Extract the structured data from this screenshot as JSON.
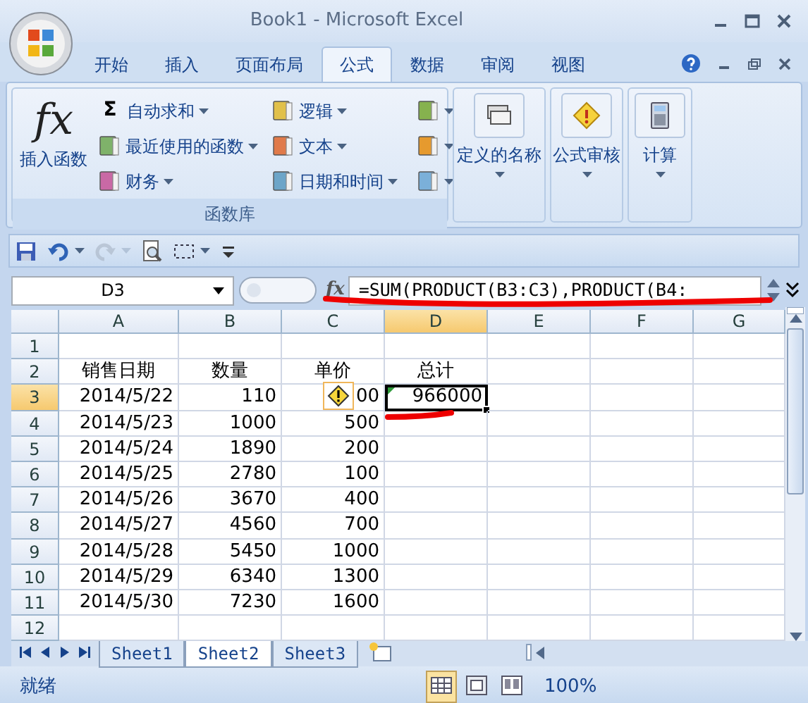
{
  "window": {
    "title": "Book1 - Microsoft Excel"
  },
  "ribbon_tabs": [
    {
      "label": "开始",
      "selected": false
    },
    {
      "label": "插入",
      "selected": false
    },
    {
      "label": "页面布局",
      "selected": false
    },
    {
      "label": "公式",
      "selected": true
    },
    {
      "label": "数据",
      "selected": false
    },
    {
      "label": "审阅",
      "selected": false
    },
    {
      "label": "视图",
      "selected": false
    }
  ],
  "function_library": {
    "label": "函数库",
    "insert_function": {
      "glyph": "fx",
      "label": "插入函数"
    },
    "items": [
      {
        "kind": "sigma",
        "icon_text": "Σ",
        "label": "自动求和"
      },
      {
        "kind": "book",
        "label": "最近使用的函数"
      },
      {
        "kind": "book",
        "label": "财务"
      },
      {
        "kind": "book",
        "label": "逻辑"
      },
      {
        "kind": "book",
        "label": "文本"
      },
      {
        "kind": "book",
        "label": "日期和时间"
      },
      {
        "kind": "icon"
      },
      {
        "kind": "icon"
      },
      {
        "kind": "icon"
      }
    ]
  },
  "ribbon_groups": [
    {
      "label": "定义的名称",
      "kind": "names"
    },
    {
      "label": "公式审核",
      "kind": "audit"
    },
    {
      "label": "计算",
      "kind": "calc"
    }
  ],
  "quick_access": [
    {
      "kind": "save",
      "disabled": false
    },
    {
      "kind": "undo",
      "disabled": false,
      "dropdown": true
    },
    {
      "kind": "redo",
      "disabled": true,
      "dropdown": true
    },
    {
      "kind": "preview",
      "disabled": false
    },
    {
      "kind": "select",
      "disabled": false,
      "dropdown": true
    },
    {
      "kind": "customize",
      "disabled": false
    }
  ],
  "formula_bar": {
    "name_box": "D3",
    "fx": "fx",
    "formula": "=SUM(PRODUCT(B3:C3),PRODUCT(B4:"
  },
  "columns": [
    {
      "label": "A",
      "selected": false
    },
    {
      "label": "B",
      "selected": false
    },
    {
      "label": "C",
      "selected": false
    },
    {
      "label": "D",
      "selected": true
    },
    {
      "label": "E",
      "selected": false
    },
    {
      "label": "F",
      "selected": false
    },
    {
      "label": "G",
      "selected": false
    }
  ],
  "rows": [
    {
      "label": "1",
      "selected": false,
      "cells": []
    },
    {
      "label": "2",
      "selected": false,
      "kind": "heading",
      "cells": [
        {
          "text": "销售日期"
        },
        {
          "text": "数量"
        },
        {
          "text": "单价"
        },
        {
          "text": "总计"
        }
      ]
    },
    {
      "label": "3",
      "selected": true,
      "kind": "data",
      "cells": [
        {
          "text": "2014/5/22"
        },
        {
          "text": "110"
        },
        {
          "text": "00",
          "error_button": true
        },
        {
          "text": "966000",
          "active": true,
          "error_indicator": true
        }
      ]
    },
    {
      "label": "4",
      "selected": false,
      "kind": "data",
      "cells": [
        {
          "text": "2014/5/23"
        },
        {
          "text": "1000"
        },
        {
          "text": "500"
        }
      ]
    },
    {
      "label": "5",
      "selected": false,
      "kind": "data",
      "cells": [
        {
          "text": "2014/5/24"
        },
        {
          "text": "1890"
        },
        {
          "text": "200"
        }
      ]
    },
    {
      "label": "6",
      "selected": false,
      "kind": "data",
      "cells": [
        {
          "text": "2014/5/25"
        },
        {
          "text": "2780"
        },
        {
          "text": "100"
        }
      ]
    },
    {
      "label": "7",
      "selected": false,
      "kind": "data",
      "cells": [
        {
          "text": "2014/5/26"
        },
        {
          "text": "3670"
        },
        {
          "text": "400"
        }
      ]
    },
    {
      "label": "8",
      "selected": false,
      "kind": "data",
      "cells": [
        {
          "text": "2014/5/27"
        },
        {
          "text": "4560"
        },
        {
          "text": "700"
        }
      ]
    },
    {
      "label": "9",
      "selected": false,
      "kind": "data",
      "cells": [
        {
          "text": "2014/5/28"
        },
        {
          "text": "5450"
        },
        {
          "text": "1000"
        }
      ]
    },
    {
      "label": "10",
      "selected": false,
      "kind": "data",
      "cells": [
        {
          "text": "2014/5/29"
        },
        {
          "text": "6340"
        },
        {
          "text": "1300"
        }
      ]
    },
    {
      "label": "11",
      "selected": false,
      "kind": "data",
      "cells": [
        {
          "text": "2014/5/30"
        },
        {
          "text": "7230"
        },
        {
          "text": "1600"
        }
      ]
    },
    {
      "label": "12",
      "selected": false,
      "cells": []
    }
  ],
  "sheet_tabs": [
    {
      "label": "Sheet1",
      "selected": false
    },
    {
      "label": "Sheet2",
      "selected": true
    },
    {
      "label": "Sheet3",
      "selected": false
    }
  ],
  "status_bar": {
    "status": "就绪",
    "views": [
      {
        "kind": "normal",
        "selected": true
      },
      {
        "kind": "layout",
        "selected": false
      },
      {
        "kind": "pagebreak",
        "selected": false
      }
    ],
    "zoom": "100%"
  }
}
